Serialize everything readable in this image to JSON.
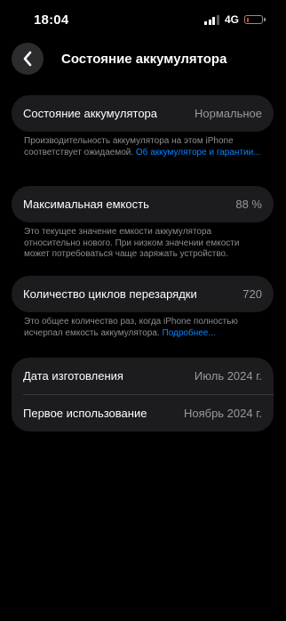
{
  "status_bar": {
    "time": "18:04",
    "network": "4G",
    "battery_level": 0.1,
    "battery_color": "#ff3b30"
  },
  "nav": {
    "title": "Состояние аккумулятора",
    "back_icon": "chevron-left-icon"
  },
  "battery_state": {
    "label": "Состояние аккумулятора",
    "value": "Нормальное",
    "footnote_text": "Производительность аккумулятора на этом iPhone соответствует ожидаемой. ",
    "footnote_link": "Об аккумуляторе и гарантии..."
  },
  "max_capacity": {
    "label": "Максимальная емкость",
    "value": "88 %",
    "footnote_text": "Это текущее значение емкости аккумулятора относительно нового. При низком значении емкости может потребоваться чаще заряжать устройство."
  },
  "cycle_count": {
    "label": "Количество циклов перезарядки",
    "value": "720",
    "footnote_text": "Это общее количество раз, когда iPhone полностью исчерпал емкость аккумулятора. ",
    "footnote_link": "Подробнее..."
  },
  "dates": {
    "manufacture_label": "Дата изготовления",
    "manufacture_value": "Июль 2024 г.",
    "first_use_label": "Первое использование",
    "first_use_value": "Ноябрь 2024 г."
  },
  "colors": {
    "background": "#000000",
    "card": "#1c1c1e",
    "link": "#0a84ff",
    "secondary_text": "#8e8e93"
  }
}
